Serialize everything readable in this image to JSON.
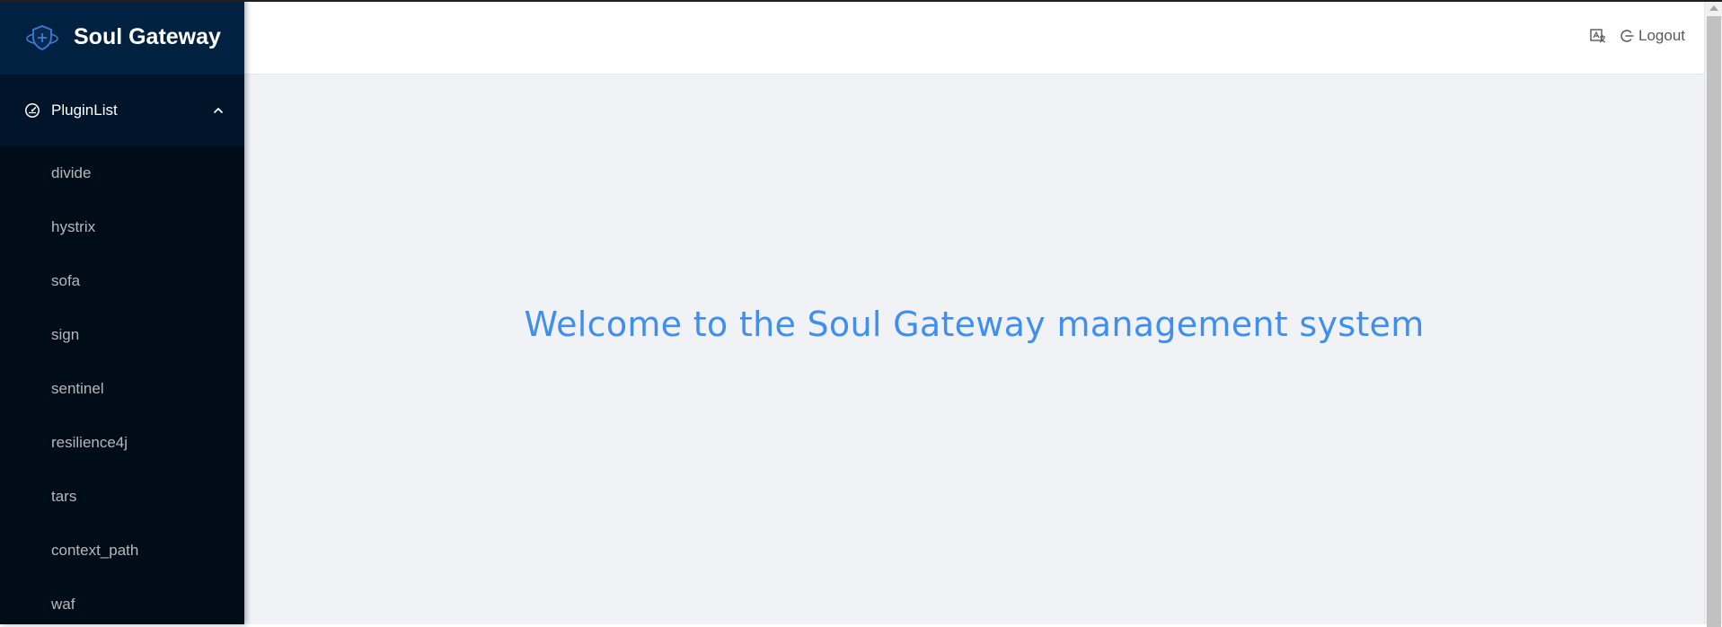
{
  "app": {
    "title": "Soul Gateway"
  },
  "sidebar": {
    "submenu": {
      "label": "PluginList",
      "icon": "dashboard-icon",
      "expanded": true
    },
    "items": [
      {
        "label": "divide"
      },
      {
        "label": "hystrix"
      },
      {
        "label": "sofa"
      },
      {
        "label": "sign"
      },
      {
        "label": "sentinel"
      },
      {
        "label": "resilience4j"
      },
      {
        "label": "tars"
      },
      {
        "label": "context_path"
      },
      {
        "label": "waf"
      }
    ]
  },
  "header": {
    "language_icon": "translate-icon",
    "logout_label": "Logout",
    "logout_icon": "logout-icon"
  },
  "main": {
    "welcome_text": "Welcome to the Soul Gateway management system"
  },
  "colors": {
    "sidebar_bg": "#000c17",
    "logo_bg": "#002140",
    "submenu_bg": "#001529",
    "content_bg": "#f0f2f5",
    "welcome_text": "#3f8ff0",
    "logo_accent": "#3a7bd5"
  }
}
